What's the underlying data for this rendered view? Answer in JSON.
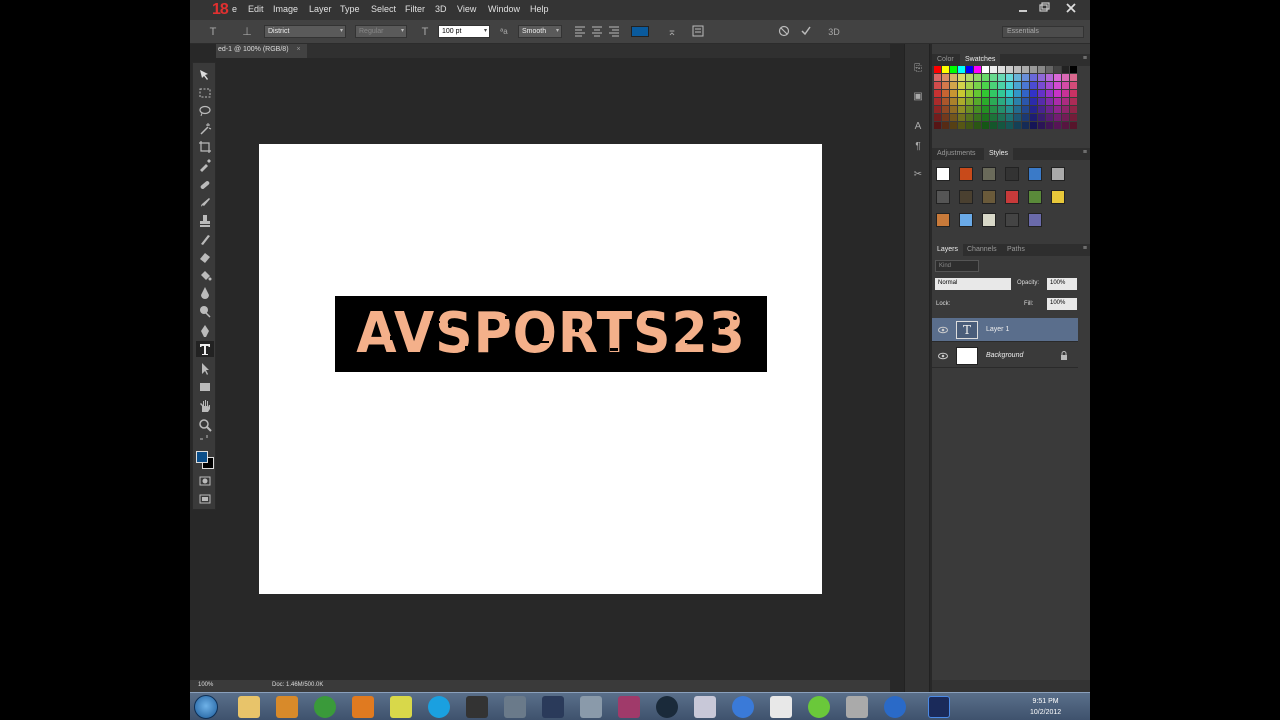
{
  "app": {
    "logo_text": "18",
    "menu": [
      "e",
      "Edit",
      "Image",
      "Layer",
      "Type",
      "Select",
      "Filter",
      "3D",
      "View",
      "Window",
      "Help"
    ]
  },
  "options_bar": {
    "font_family": "District",
    "font_style": "Regular",
    "font_size": "100 pt",
    "antialias": "Smooth",
    "text_color": "#0a5a9c",
    "workspace": "Essentials",
    "three_d_label": "3D"
  },
  "document": {
    "tab_title": "ed-1 @ 100% (RGB/8)",
    "close_glyph": "×",
    "text_content": "AVSPORTS23",
    "text_color": "#f4b08a",
    "background_color": "#000000"
  },
  "status_bar": {
    "zoom": "100%",
    "doc_size": "Doc: 1.46M/500.0K"
  },
  "panels": {
    "color_tabs": [
      "Color",
      "Swatches"
    ],
    "styles_tabs": [
      "Adjustments",
      "Styles"
    ],
    "layers_tabs": [
      "Layers",
      "Channels",
      "Paths"
    ],
    "kind_filter": "Kind",
    "blend_mode": "Normal",
    "opacity_label": "Opacity:",
    "opacity_value": "100%",
    "lock_label": "Lock:",
    "fill_label": "Fill:",
    "fill_value": "100%",
    "layers": [
      {
        "name": "Layer 1",
        "type": "text",
        "selected": true
      },
      {
        "name": "Background",
        "type": "image",
        "locked": true
      }
    ]
  },
  "colors": {
    "foreground": "#0a4e8a",
    "background": "#000000"
  },
  "taskbar": {
    "time": "9:51 PM",
    "date": "10/2/2012"
  }
}
